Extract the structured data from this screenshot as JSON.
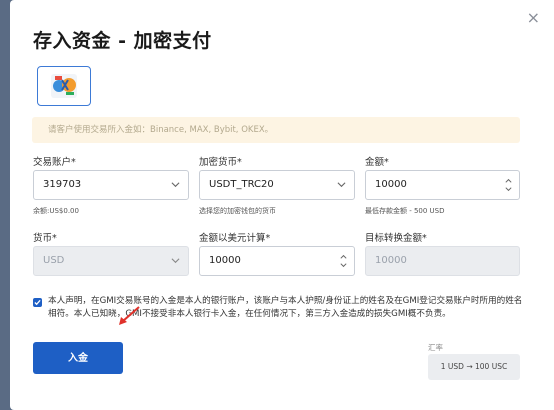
{
  "dialog": {
    "title": "存入资金 - 加密支付",
    "close_glyph": "×"
  },
  "payment_method": {
    "icon": "crypto-payment-icon"
  },
  "notice": "请客户使用交易所入金如：Binance, MAX, Bybit, OKEX。",
  "form": {
    "account": {
      "label": "交易账户",
      "required": "*",
      "value": "319703",
      "hint": "余额:US$0.00"
    },
    "crypto": {
      "label": "加密货币",
      "required": "*",
      "value": "USDT_TRC20",
      "hint": "选择您的加密钱包的货币"
    },
    "amount": {
      "label": "金额",
      "required": "*",
      "value": "10000",
      "hint": "最低存款金额 - 500 USD"
    },
    "currency": {
      "label": "货币",
      "required": "*",
      "value": "USD"
    },
    "usd_amount": {
      "label": "金额以美元计算",
      "required": "*",
      "value": "10000"
    },
    "target_amount": {
      "label": "目标转换金额",
      "required": "*",
      "value": "10000"
    }
  },
  "declaration": {
    "checked": true,
    "text": "本人声明，在GMI交易账号的入金是本人的银行账户，该账户与本人护照/身份证上的姓名及在GMI登记交易账户时所用的姓名相符。本人已知晓，GMI不接受非本人银行卡入金，在任何情况下，第三方入金造成的损失GMI概不负责。"
  },
  "deposit_button": "入金",
  "exchange_rate": {
    "label": "汇率",
    "value": "1 USD → 100 USC"
  },
  "colors": {
    "primary": "#1e5fc5",
    "notice_bg": "#fdf4e3",
    "arrow": "#e0322b"
  }
}
